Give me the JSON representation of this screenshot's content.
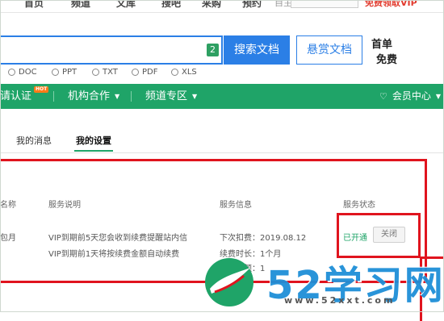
{
  "topnav": {
    "items": [
      "首页",
      "频道",
      "文库",
      "搜吧",
      "采购",
      "预约"
    ],
    "right_link": "自主设置",
    "vip_link": "免费领取VIP"
  },
  "search": {
    "badge": "2",
    "search_button": "搜索文档",
    "reward_button": "悬赏文档",
    "promo_line1": "首单",
    "promo_line2": "免费"
  },
  "file_types": [
    "DOC",
    "PPT",
    "TXT",
    "PDF",
    "XLS"
  ],
  "menu": {
    "items": [
      {
        "label": "请认证",
        "badge": "HOT",
        "caret": false
      },
      {
        "label": "机构合作",
        "caret": true
      },
      {
        "label": "频道专区",
        "caret": true
      }
    ],
    "member_center": "会员中心",
    "caret_icon": "▼"
  },
  "tabs": [
    {
      "label": "我的消息",
      "active": false
    },
    {
      "label": "我的设置",
      "active": true
    }
  ],
  "table": {
    "headers": {
      "name": "名称",
      "description": "服务说明",
      "info": "服务信息",
      "status": "服务状态"
    },
    "row": {
      "name": "包月",
      "desc_line1": "VIP到期前5天您会收到续费提醒站内信",
      "desc_line2": "VIP到期前1天将按续费金额自动续费",
      "info_line1": "下次扣费：2019.08.12",
      "info_line2": "续费时长：1个月",
      "info_line3": "续费金额：1",
      "status": "已开通",
      "action": "关闭"
    }
  },
  "watermark": {
    "text": "52学习网",
    "url": "www.52xxt.com"
  },
  "colors": {
    "green": "#1fa468",
    "blue": "#2b7fe6",
    "red_annotation": "#e0141e"
  }
}
